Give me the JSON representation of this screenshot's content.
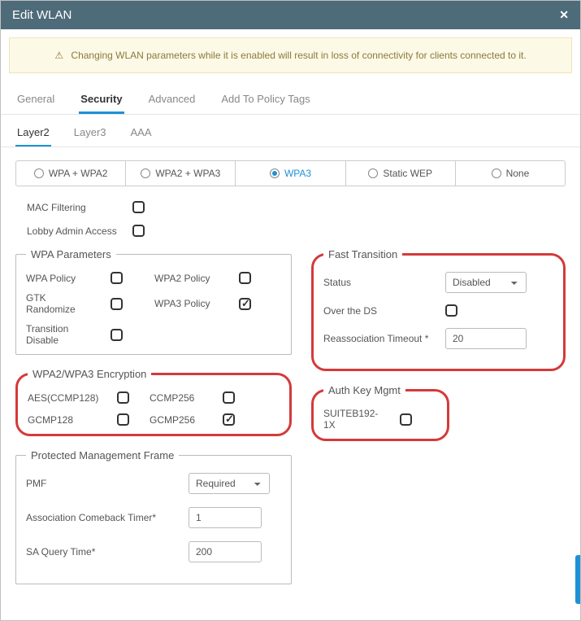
{
  "title": "Edit WLAN",
  "warning": "Changing WLAN parameters while it is enabled will result in loss of connectivity for clients connected to it.",
  "tabs": [
    "General",
    "Security",
    "Advanced",
    "Add To Policy Tags"
  ],
  "active_tab": 1,
  "subtabs": [
    "Layer2",
    "Layer3",
    "AAA"
  ],
  "active_subtab": 0,
  "wpa_modes": [
    "WPA + WPA2",
    "WPA2 + WPA3",
    "WPA3",
    "Static WEP",
    "None"
  ],
  "wpa_selected": 2,
  "top_checks": {
    "mac_filtering": {
      "label": "MAC Filtering",
      "checked": false
    },
    "lobby_admin": {
      "label": "Lobby Admin Access",
      "checked": false
    }
  },
  "wpa_params": {
    "legend": "WPA Parameters",
    "items": [
      {
        "label": "WPA Policy",
        "checked": false
      },
      {
        "label": "WPA2 Policy",
        "checked": false
      },
      {
        "label": "GTK Randomize",
        "checked": false
      },
      {
        "label": "WPA3 Policy",
        "checked": true
      },
      {
        "label": "Transition Disable",
        "checked": false
      }
    ]
  },
  "encryption": {
    "legend": "WPA2/WPA3 Encryption",
    "items": [
      {
        "label": "AES(CCMP128)",
        "checked": false
      },
      {
        "label": "CCMP256",
        "checked": false
      },
      {
        "label": "GCMP128",
        "checked": false
      },
      {
        "label": "GCMP256",
        "checked": true
      }
    ]
  },
  "pmf": {
    "legend": "Protected Management Frame",
    "pmf_label": "PMF",
    "pmf_value": "Required",
    "assoc_label": "Association Comeback Timer*",
    "assoc_value": "1",
    "sa_label": "SA Query Time*",
    "sa_value": "200"
  },
  "ft": {
    "legend": "Fast Transition",
    "status_label": "Status",
    "status_value": "Disabled",
    "over_ds_label": "Over the DS",
    "over_ds_checked": false,
    "reassoc_label": "Reassociation Timeout *",
    "reassoc_value": "20"
  },
  "auth": {
    "legend": "Auth Key Mgmt",
    "item_label": "SUITEB192-1X",
    "item_checked": false
  }
}
